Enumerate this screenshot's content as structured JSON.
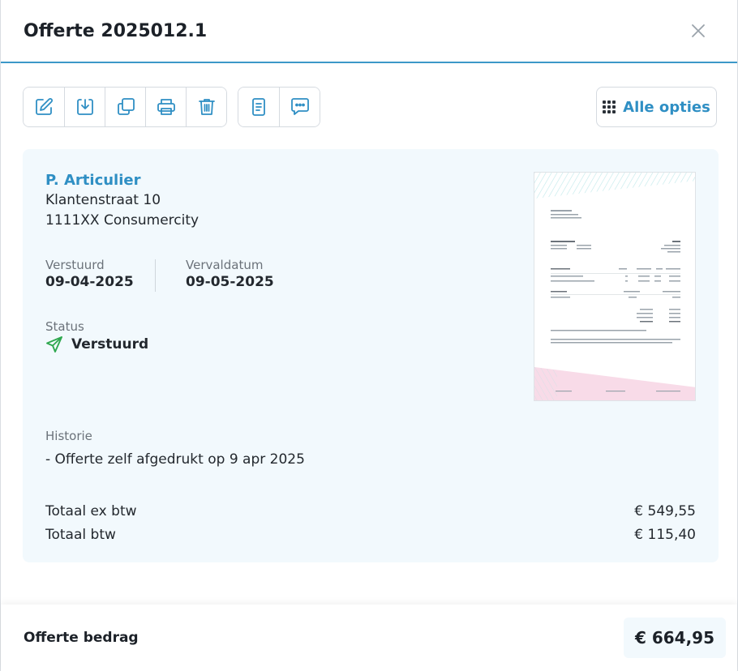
{
  "header": {
    "title": "Offerte 2025012.1"
  },
  "toolbar": {
    "group1": [
      {
        "name": "edit-button",
        "icon": "edit-icon"
      },
      {
        "name": "download-button",
        "icon": "download-icon"
      },
      {
        "name": "duplicate-button",
        "icon": "copy-icon"
      },
      {
        "name": "print-button",
        "icon": "printer-icon"
      },
      {
        "name": "delete-button",
        "icon": "trash-icon"
      }
    ],
    "group2": [
      {
        "name": "document-button",
        "icon": "document-icon"
      },
      {
        "name": "message-button",
        "icon": "chat-icon"
      }
    ],
    "options_label": "Alle opties"
  },
  "customer": {
    "name": "P. Articulier",
    "address_line1": "Klantenstraat 10",
    "address_line2": "1111XX Consumercity"
  },
  "meta": {
    "sent_label": "Verstuurd",
    "sent_value": "09-04-2025",
    "due_label": "Vervaldatum",
    "due_value": "09-05-2025",
    "status_label": "Status",
    "status_value": "Verstuurd"
  },
  "history": {
    "label": "Historie",
    "items": [
      "- Offerte zelf afgedrukt op 9 apr 2025"
    ]
  },
  "totals": {
    "ex_vat_label": "Totaal ex btw",
    "ex_vat_value": "€ 549,55",
    "vat_label": "Totaal btw",
    "vat_value": "€ 115,40"
  },
  "footer": {
    "label": "Offerte bedrag",
    "amount": "€ 664,95"
  },
  "colors": {
    "accent": "#2f8fc4",
    "status_green": "#2fa84f",
    "card_bg": "#f2f9fd"
  }
}
